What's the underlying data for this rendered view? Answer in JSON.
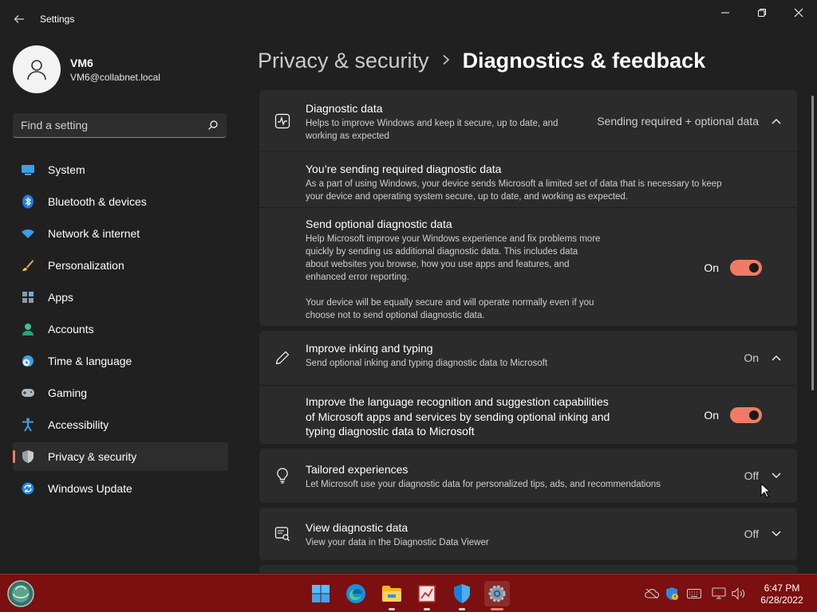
{
  "app": {
    "title": "Settings"
  },
  "profile": {
    "name": "VM6",
    "email": "VM6@collabnet.local"
  },
  "search": {
    "placeholder": "Find a setting"
  },
  "nav": {
    "items": [
      {
        "label": "System",
        "icon": "monitor-icon"
      },
      {
        "label": "Bluetooth & devices",
        "icon": "bluetooth-icon"
      },
      {
        "label": "Network & internet",
        "icon": "wifi-icon"
      },
      {
        "label": "Personalization",
        "icon": "brush-icon"
      },
      {
        "label": "Apps",
        "icon": "apps-icon"
      },
      {
        "label": "Accounts",
        "icon": "person-icon"
      },
      {
        "label": "Time & language",
        "icon": "clock-globe-icon"
      },
      {
        "label": "Gaming",
        "icon": "gamepad-icon"
      },
      {
        "label": "Accessibility",
        "icon": "accessibility-icon"
      },
      {
        "label": "Privacy & security",
        "icon": "shield-icon",
        "active": true
      },
      {
        "label": "Windows Update",
        "icon": "update-icon"
      }
    ]
  },
  "breadcrumb": {
    "parent": "Privacy & security",
    "separator": ">",
    "current": "Diagnostics & feedback"
  },
  "diagnostic": {
    "title": "Diagnostic data",
    "desc1": "Helps to improve Windows and keep it secure, up to date, and",
    "desc2": "working as expected",
    "status": "Sending required + optional data",
    "required": {
      "title": "You’re sending required diagnostic data",
      "desc1": "As a part of using Windows, your device sends Microsoft a limited set of data that is necessary to keep",
      "desc2": "your device and operating system secure, up to date, and working as expected."
    },
    "optional": {
      "title": "Send optional diagnostic data",
      "desc1": "Help Microsoft improve your Windows experience and fix problems more",
      "desc2": "quickly by sending us additional diagnostic data. This includes data",
      "desc3": "about websites you browse, how you use apps and features, and",
      "desc4": "enhanced error reporting.",
      "desc5": "Your device will be equally secure and will operate normally even if you",
      "desc6": "choose not to send optional diagnostic data.",
      "state": "On"
    }
  },
  "inking": {
    "title": "Improve inking and typing",
    "desc": "Send optional inking and typing diagnostic data to Microsoft",
    "status": "On",
    "sub": {
      "line1": "Improve the language recognition and suggestion capabilities",
      "line2": "of Microsoft apps and services by sending optional inking and",
      "line3": "typing diagnostic data to Microsoft",
      "state": "On"
    }
  },
  "tailored": {
    "title": "Tailored experiences",
    "desc": "Let Microsoft use your diagnostic data for personalized tips, ads, and recommendations",
    "status": "Off"
  },
  "viewdata": {
    "title": "View diagnostic data",
    "desc": "View your data in the Diagnostic Data Viewer",
    "status": "Off"
  },
  "taskbar": {
    "time": "6:47 PM",
    "date": "6/28/2022"
  },
  "colors": {
    "accent": "#f07b65",
    "taskbar": "#7c0f0f",
    "background": "#202020",
    "card": "#2b2b2b"
  }
}
